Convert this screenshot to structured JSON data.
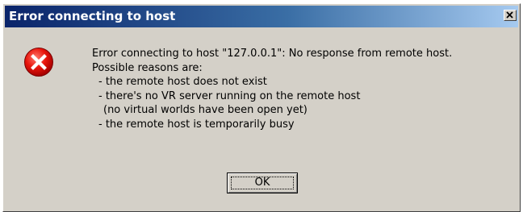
{
  "window": {
    "title": "Error connecting to host",
    "close_icon": "close-x-icon"
  },
  "content": {
    "icon": "error-icon",
    "message_lines": [
      "Error connecting to host \"127.0.0.1\": No response from remote host.",
      "Possible reasons are:",
      "- the remote host does not exist",
      "- there's no VR server running on the remote host",
      "(no virtual worlds have been open yet)",
      "- the remote host is temporarily busy"
    ]
  },
  "buttons": {
    "ok_label": "OK"
  },
  "colors": {
    "titlebar_start": "#0a246a",
    "titlebar_end": "#a6caf0",
    "dialog_bg": "#d4d0c8",
    "error_red": "#e8150c"
  }
}
